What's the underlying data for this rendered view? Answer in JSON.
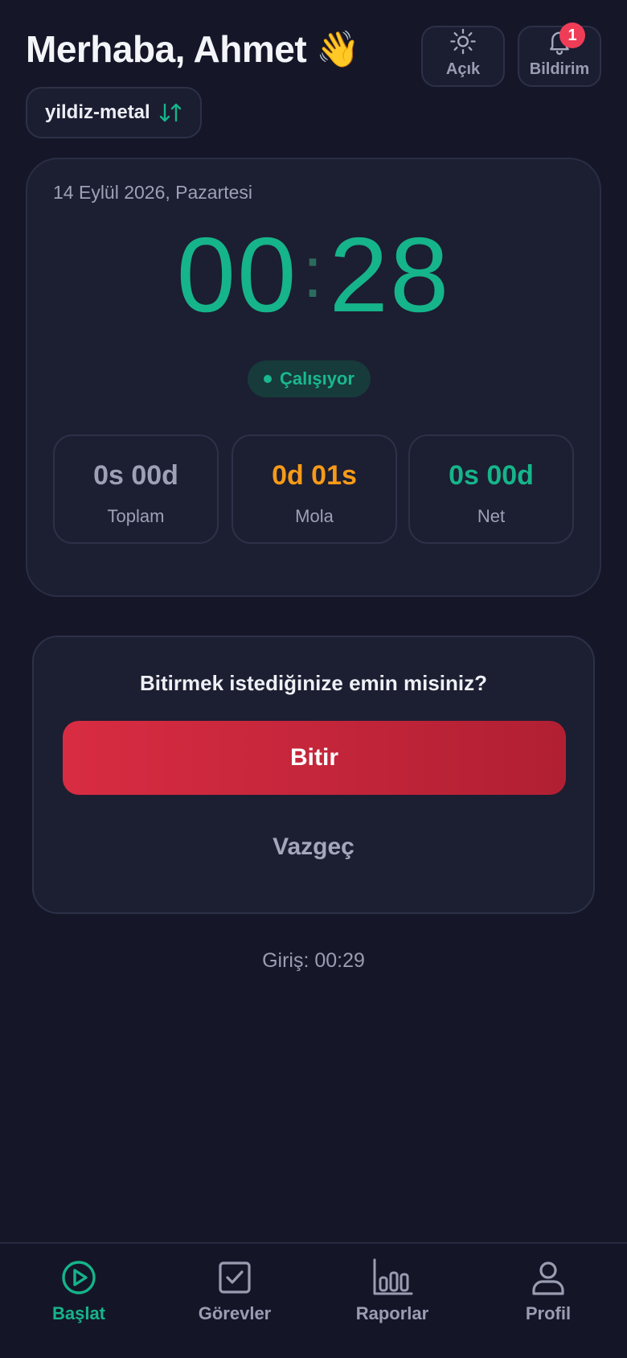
{
  "header": {
    "greeting": "Merhaba, Ahmet",
    "wave_emoji": "👋",
    "theme_button_label": "Açık",
    "notification_button_label": "Bildirim",
    "notification_count": "1"
  },
  "workspace": {
    "name": "yildiz-metal",
    "icon": "swap-vertical-icon"
  },
  "timer": {
    "date": "14 Eylül 2026, Pazartesi",
    "minutes": "00",
    "seconds": "28",
    "status": "Çalışıyor",
    "stats": {
      "total_value": "0s 00d",
      "total_label": "Toplam",
      "break_value": "0d 01s",
      "break_label": "Mola",
      "net_value": "0s 00d",
      "net_label": "Net"
    }
  },
  "confirm": {
    "question": "Bitirmek istediğinize emin misiniz?",
    "finish_label": "Bitir",
    "cancel_label": "Vazgeç"
  },
  "checkin": "Giriş: 00:29",
  "nav": {
    "items": [
      {
        "label": "Başlat",
        "icon": "play-circle-icon",
        "active": true
      },
      {
        "label": "Görevler",
        "icon": "checkbox-icon",
        "active": false
      },
      {
        "label": "Raporlar",
        "icon": "bar-chart-icon",
        "active": false
      },
      {
        "label": "Profil",
        "icon": "user-icon",
        "active": false
      }
    ]
  },
  "colors": {
    "background": "#151729",
    "accent_green": "#16b48a",
    "break_orange": "#f79a18",
    "danger_red": "#d82c42",
    "badge_red": "#ef3d57"
  }
}
